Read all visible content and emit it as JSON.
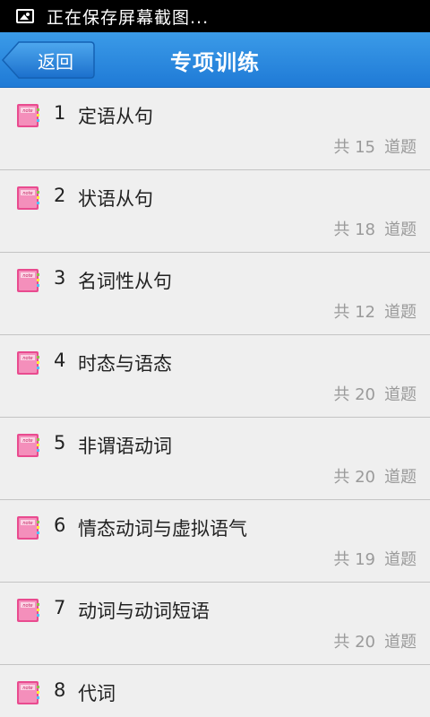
{
  "status_bar": {
    "text": "正在保存屏幕截图..."
  },
  "title_bar": {
    "back_label": "返回",
    "title": "专项训练"
  },
  "items": [
    {
      "index": "1",
      "title": "定语从句",
      "count": "共 15",
      "unit": "道题"
    },
    {
      "index": "2",
      "title": "状语从句",
      "count": "共 18",
      "unit": "道题"
    },
    {
      "index": "3",
      "title": "名词性从句",
      "count": "共 12",
      "unit": "道题"
    },
    {
      "index": "4",
      "title": "时态与语态",
      "count": "共 20",
      "unit": "道题"
    },
    {
      "index": "5",
      "title": "非谓语动词",
      "count": "共 20",
      "unit": "道题"
    },
    {
      "index": "6",
      "title": "情态动词与虚拟语气",
      "count": "共 19",
      "unit": "道题"
    },
    {
      "index": "7",
      "title": "动词与动词短语",
      "count": "共 20",
      "unit": "道题"
    },
    {
      "index": "8",
      "title": "代词",
      "count": "",
      "unit": ""
    }
  ],
  "icons": {
    "status": "screenshot-picture-icon",
    "list": "note-book-icon"
  }
}
